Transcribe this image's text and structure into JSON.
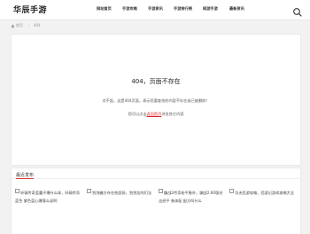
{
  "header": {
    "logo": "华辰手游",
    "nav": [
      "网站首页",
      "手游攻略",
      "手游资讯",
      "手游排行榜",
      "网游手游",
      "最新资讯"
    ]
  },
  "breadcrumb": {
    "home": "首页",
    "separator": "›",
    "current": "404"
  },
  "error": {
    "title": "404，页面不存在",
    "message": "对不起，这是404页面，表示您要查找的内容不存在或已被删除！",
    "prefix": "您可以点击",
    "link": "返回首页",
    "suffix": "浏览其它内容"
  },
  "recent": {
    "title": "最近发布",
    "posts": [
      {
        "title": "轩辕传奇蓝魔子爆什么球，轩辕传奇蓝色 紫色蓝心爆落么说明"
      },
      {
        "title": "泡泡糖方舟在他面前，泡泡龙的们法"
      },
      {
        "title": "蹦战2传奇秘平衡外，蹦战2.60版份 击经平 装体配 配方叫什么"
      },
      {
        "title": "功夫西游攻略，西游记游戏攻略大全"
      }
    ]
  }
}
